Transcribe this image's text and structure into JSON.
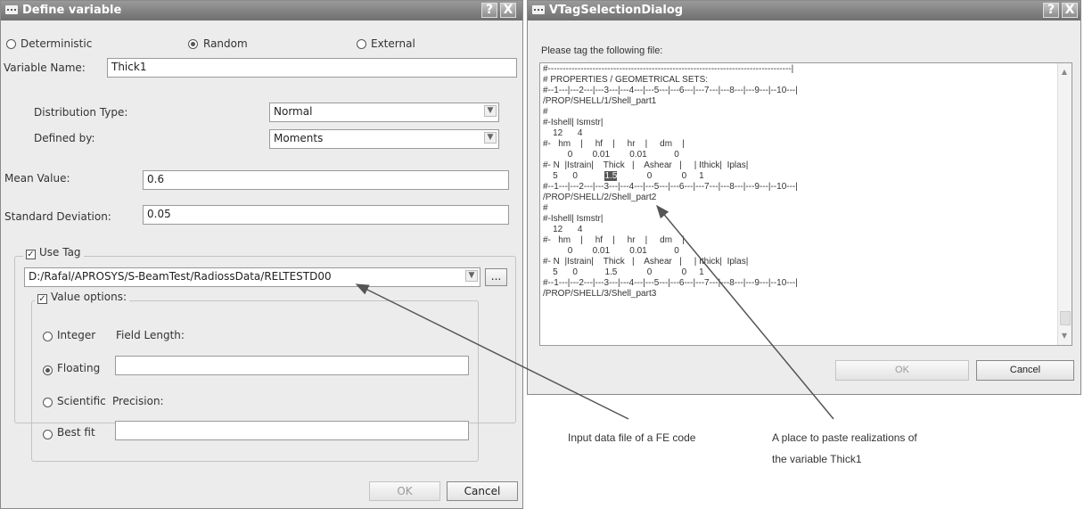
{
  "define_window": {
    "title": "Define variable",
    "help_button": "?",
    "close_button": "X",
    "radios": [
      {
        "label": "Deterministic",
        "selected": false
      },
      {
        "label": "Random",
        "selected": true
      },
      {
        "label": "External",
        "selected": false
      }
    ],
    "variable_name_label": "Variable Name:",
    "variable_name_value": "Thick1",
    "distribution_type_label": "Distribution Type:",
    "distribution_type_value": "Normal",
    "defined_by_label": "Defined by:",
    "defined_by_value": "Moments",
    "mean_label": "Mean Value:",
    "mean_value": "0.6",
    "std_label": "Standard Deviation:",
    "std_value": "0.05",
    "use_tag_label": "Use Tag",
    "use_tag_checked": true,
    "file_path": "D:/Rafal/APROSYS/S-BeamTest/RadiossData/RELTESTD00",
    "browse_label": "...",
    "value_options_label": "Value options:",
    "value_options_checked": true,
    "options": [
      {
        "label": "Integer",
        "selected": false,
        "field_label": "Field Length:"
      },
      {
        "label": "Floating",
        "selected": true
      },
      {
        "label": "Scientific",
        "selected": false,
        "field_label": "Precision:"
      },
      {
        "label": "Best fit",
        "selected": false
      }
    ],
    "ok_label": "OK",
    "cancel_label": "Cancel"
  },
  "tag_window": {
    "title": "VTagSelectionDialog",
    "help_button": "?",
    "close_button": "X",
    "prompt": "Please tag the following file:",
    "file_lines": [
      "#----------------------------------------------------------------------------------|",
      "# PROPERTIES / GEOMETRICAL SETS:",
      "#--1---|---2---|---3---|---4---|---5---|---6---|---7---|---8---|---9---|--10---|",
      "/PROP/SHELL/1/Shell_part1",
      "#",
      "#-Ishell| Ismstr|",
      "    12      4",
      "#-   hm    |     hf    |     hr    |     dm    |",
      "          0        0.01        0.01           0",
      "#- N  |Istrain|    Thick   |    Ashear   |     | Ithick|  Iplas|",
      "    5      0           1.5            0            0     1",
      "#--1---|---2---|---3---|---4---|---5---|---6---|---7---|---8---|---9---|--10---|",
      "/PROP/SHELL/2/Shell_part2",
      "#",
      "#-Ishell| Ismstr|",
      "    12      4",
      "#-   hm    |     hf    |     hr    |     dm    |",
      "          0        0.01        0.01           0",
      "#- N  |Istrain|    Thick   |    Ashear   |     | Ithick|  Iplas|",
      "    5      0           1.5            0            0     1",
      "#--1---|---2---|---3---|---4---|---5---|---6---|---7---|---8---|---9---|--10---|",
      "/PROP/SHELL/3/Shell_part3"
    ],
    "ok_label": "OK",
    "cancel_label": "Cancel"
  },
  "annotations": {
    "input_file": "Input data file of a FE code",
    "paste_place_line1": "A place to paste realizations of",
    "paste_place_line2": "the variable  Thick1"
  }
}
